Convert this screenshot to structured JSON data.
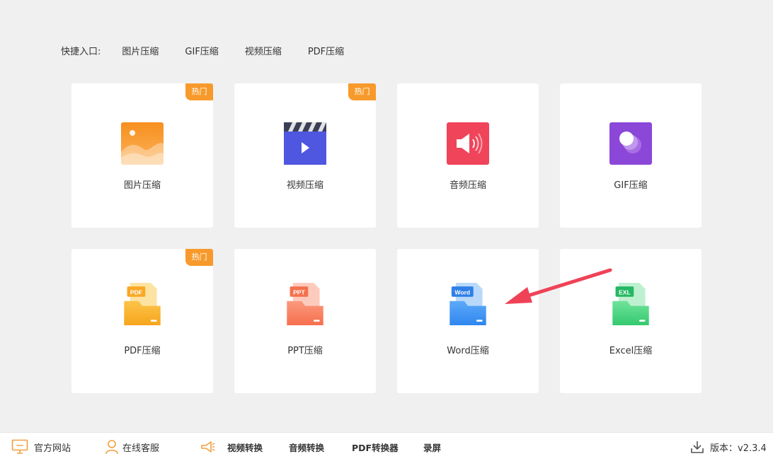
{
  "quick_entry": {
    "label": "快捷入口:",
    "items": [
      "图片压缩",
      "GIF压缩",
      "视频压缩",
      "PDF压缩"
    ]
  },
  "tiles": [
    {
      "label": "图片压缩",
      "badge": "热门",
      "icon": "image-icon"
    },
    {
      "label": "视频压缩",
      "badge": "热门",
      "icon": "video-icon"
    },
    {
      "label": "音频压缩",
      "badge": "",
      "icon": "audio-icon"
    },
    {
      "label": "GIF压缩",
      "badge": "",
      "icon": "gif-icon"
    },
    {
      "label": "PDF压缩",
      "badge": "热门",
      "icon": "pdf-file-icon",
      "icon_text": "PDF"
    },
    {
      "label": "PPT压缩",
      "badge": "",
      "icon": "ppt-file-icon",
      "icon_text": "PPT"
    },
    {
      "label": "Word压缩",
      "badge": "",
      "icon": "word-file-icon",
      "icon_text": "Word"
    },
    {
      "label": "Excel压缩",
      "badge": "",
      "icon": "excel-file-icon",
      "icon_text": "EXL"
    }
  ],
  "footer": {
    "official_site": "官方网站",
    "online_support": "在线客服",
    "links": [
      "视频转换",
      "音频转换",
      "PDF转换器",
      "录屏"
    ],
    "version": "版本：v2.3.4"
  },
  "colors": {
    "badge": "#f79a2b",
    "image": "#f7a234",
    "video": "#4f56e0",
    "audio": "#f0445a",
    "gif": "#8b47d8",
    "pdf": "#f9b82a",
    "ppt": "#f77d5e",
    "word": "#3f95f4",
    "excel": "#3fd27a",
    "arrow": "#ef4257"
  }
}
